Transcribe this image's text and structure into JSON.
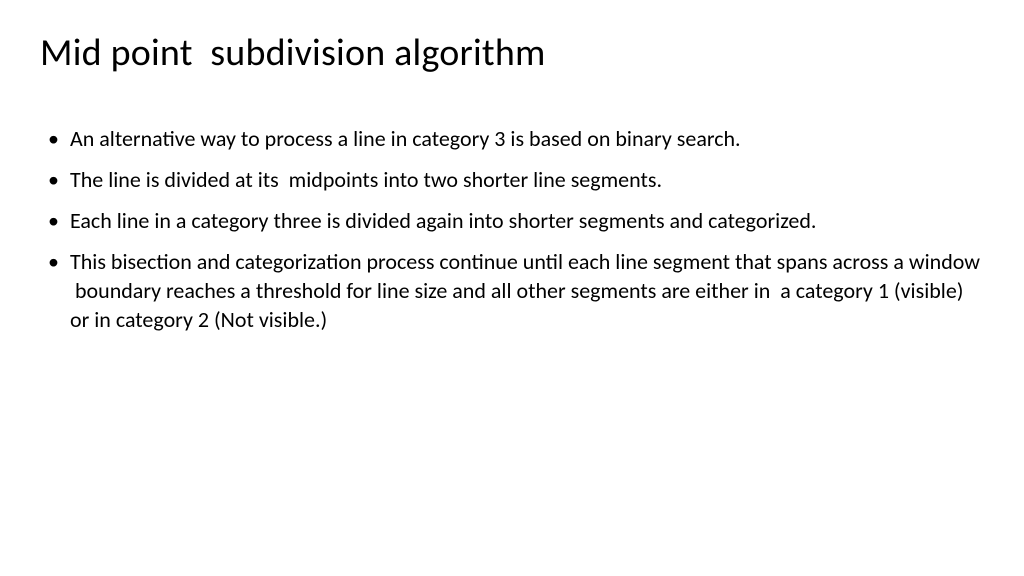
{
  "title": "Mid point  subdivision algorithm",
  "bullets": [
    "An alternative way to process a line in category 3 is based on binary search.",
    "The line is divided at its  midpoints into two shorter line segments.",
    "Each line in a category three is divided again into shorter segments and categorized.",
    "This bisection and categorization process continue until each line segment that spans across a window  boundary reaches a threshold for line size and all other segments are either in  a category 1 (visible) or in category 2 (Not visible.)"
  ]
}
